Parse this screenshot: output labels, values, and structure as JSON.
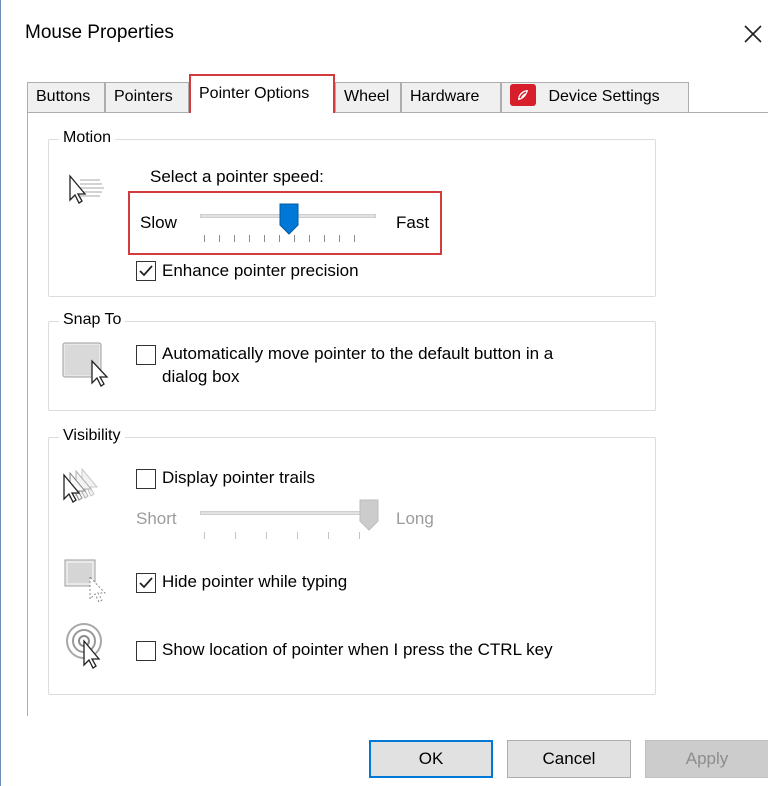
{
  "window": {
    "title": "Mouse Properties",
    "close_glyph": "×"
  },
  "tabs": [
    {
      "label": "Buttons"
    },
    {
      "label": "Pointers"
    },
    {
      "label": "Pointer Options",
      "active": true
    },
    {
      "label": "Wheel"
    },
    {
      "label": "Hardware"
    },
    {
      "label": "Device Settings",
      "icon": "synaptics-red-icon"
    }
  ],
  "motion": {
    "group_label": "Motion",
    "speed_label": "Select a pointer speed:",
    "slow_label": "Slow",
    "fast_label": "Fast",
    "speed_value": 0.5,
    "enhance_precision_label": "Enhance pointer precision",
    "enhance_precision_checked": true
  },
  "snap_to": {
    "group_label": "Snap To",
    "auto_move_label_line1": "Automatically move pointer to the default button in a",
    "auto_move_label_line2": "dialog box",
    "auto_move_checked": false
  },
  "visibility": {
    "group_label": "Visibility",
    "trails_label": "Display pointer trails",
    "trails_checked": false,
    "short_label": "Short",
    "long_label": "Long",
    "trail_length_value": 1.0,
    "hide_typing_label": "Hide pointer while typing",
    "hide_typing_checked": true,
    "show_location_label": "Show location of pointer when I press the CTRL key",
    "show_location_checked": false
  },
  "buttons": {
    "ok": "OK",
    "cancel": "Cancel",
    "apply": "Apply"
  },
  "colors": {
    "highlight": "#d23c3c",
    "accent": "#0078d7",
    "device_icon": "#d61f2b"
  }
}
